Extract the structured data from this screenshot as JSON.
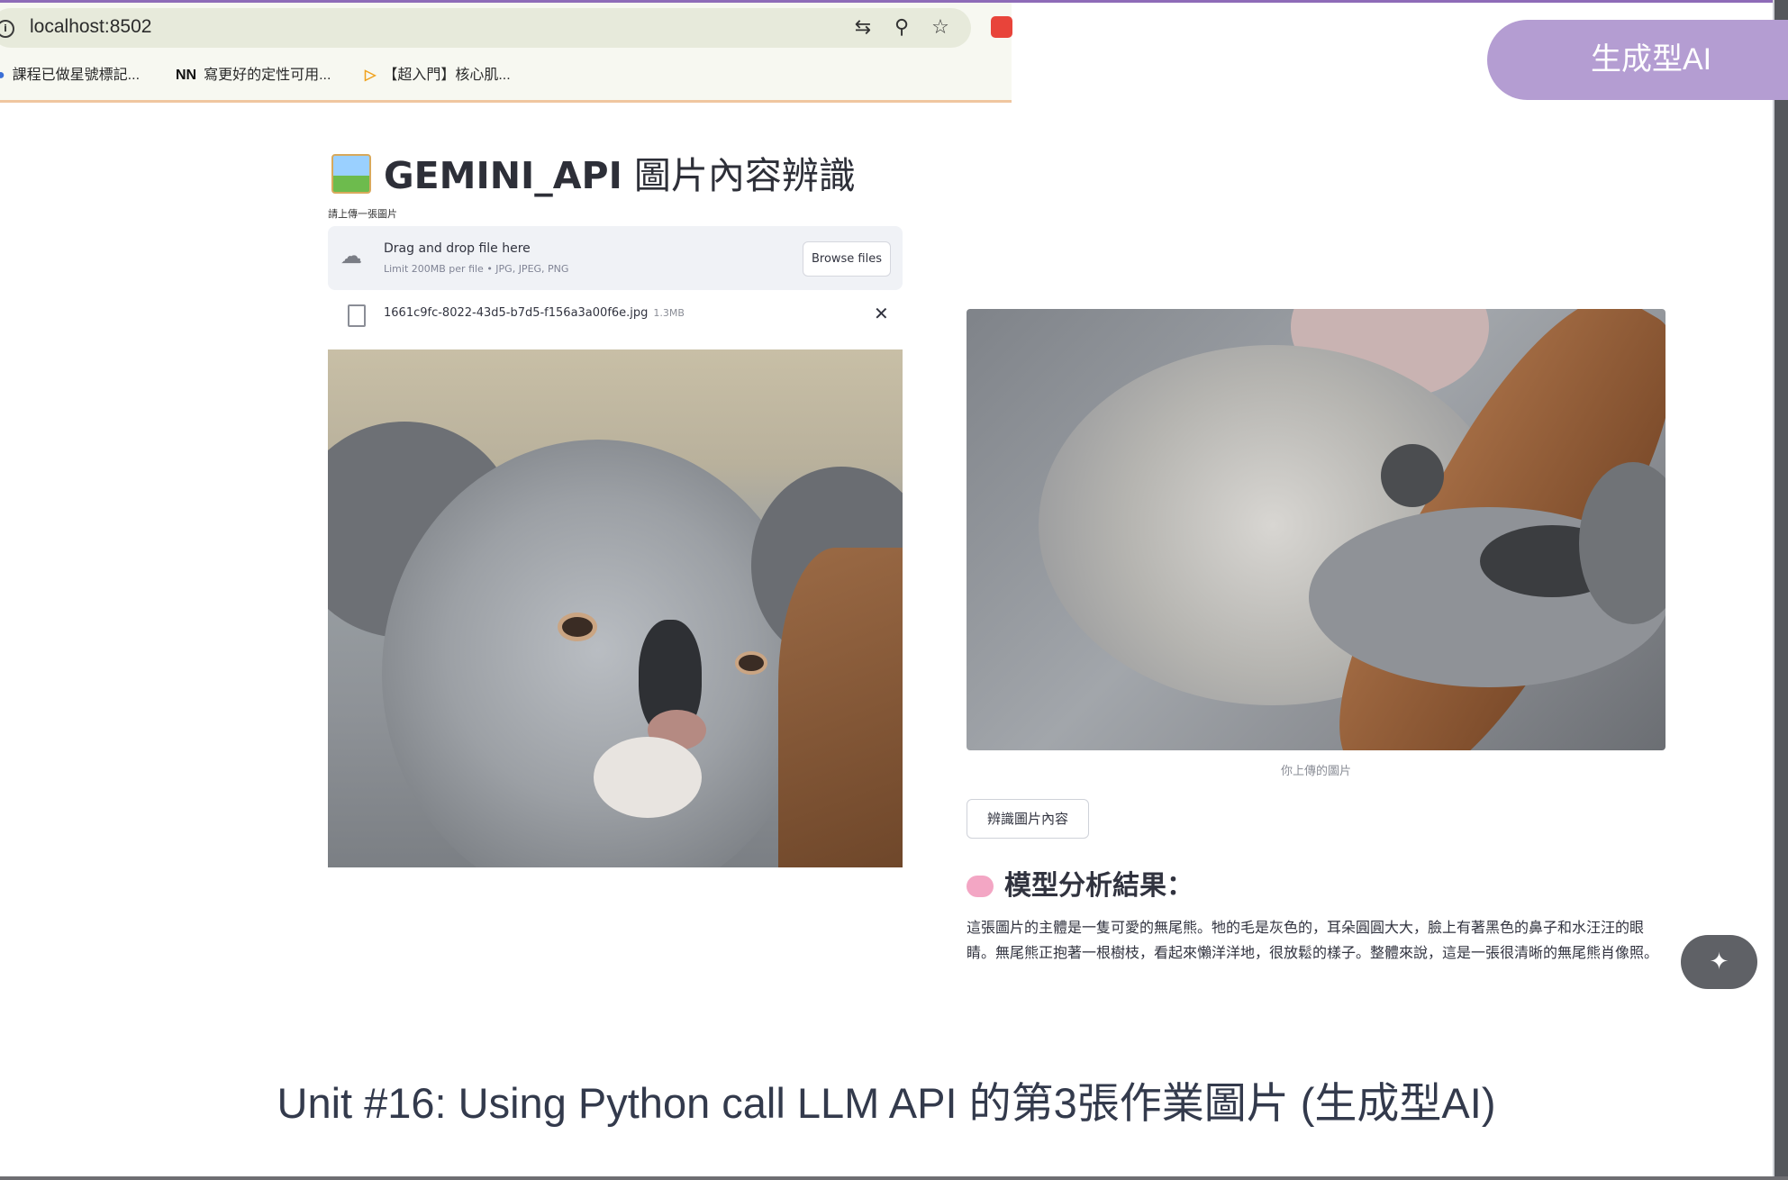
{
  "browser": {
    "url": "localhost:8502",
    "info_icon": "i",
    "bookmarks": [
      {
        "label": "課程已做星號標記..."
      },
      {
        "icon": "NN",
        "label": "寫更好的定性可用..."
      },
      {
        "label": "【超入門】核心肌..."
      }
    ]
  },
  "tag": {
    "label": "生成型AI",
    "color": "#b49dd2"
  },
  "app": {
    "title_bold": "GEMINI_API",
    "title_rest": " 圖片內容辨識",
    "upload_label": "請上傳一張圖片",
    "dropzone": {
      "main": "Drag and drop file here",
      "sub": "Limit 200MB per file • JPG, JPEG, PNG",
      "browse_label": "Browse files"
    },
    "file": {
      "name": "1661c9fc-8022-43d5-b7d5-f156a3a00f6e.jpg",
      "size": "1.3MB",
      "close": "✕"
    },
    "image_caption": "你上傳的圖片",
    "analyze_label": "辨識圖片內容",
    "result_heading": "模型分析結果：",
    "result_text": "這張圖片的主體是一隻可愛的無尾熊。牠的毛是灰色的，耳朵圓圓大大，臉上有著黑色的鼻子和水汪汪的眼睛。無尾熊正抱著一根樹枝，看起來懶洋洋地，很放鬆的樣子。整體來說，這是一張很清晰的無尾熊肖像照。"
  },
  "bottom_caption": "Unit #16: Using Python call LLM API 的第3張作業圖片 (生成型AI)"
}
